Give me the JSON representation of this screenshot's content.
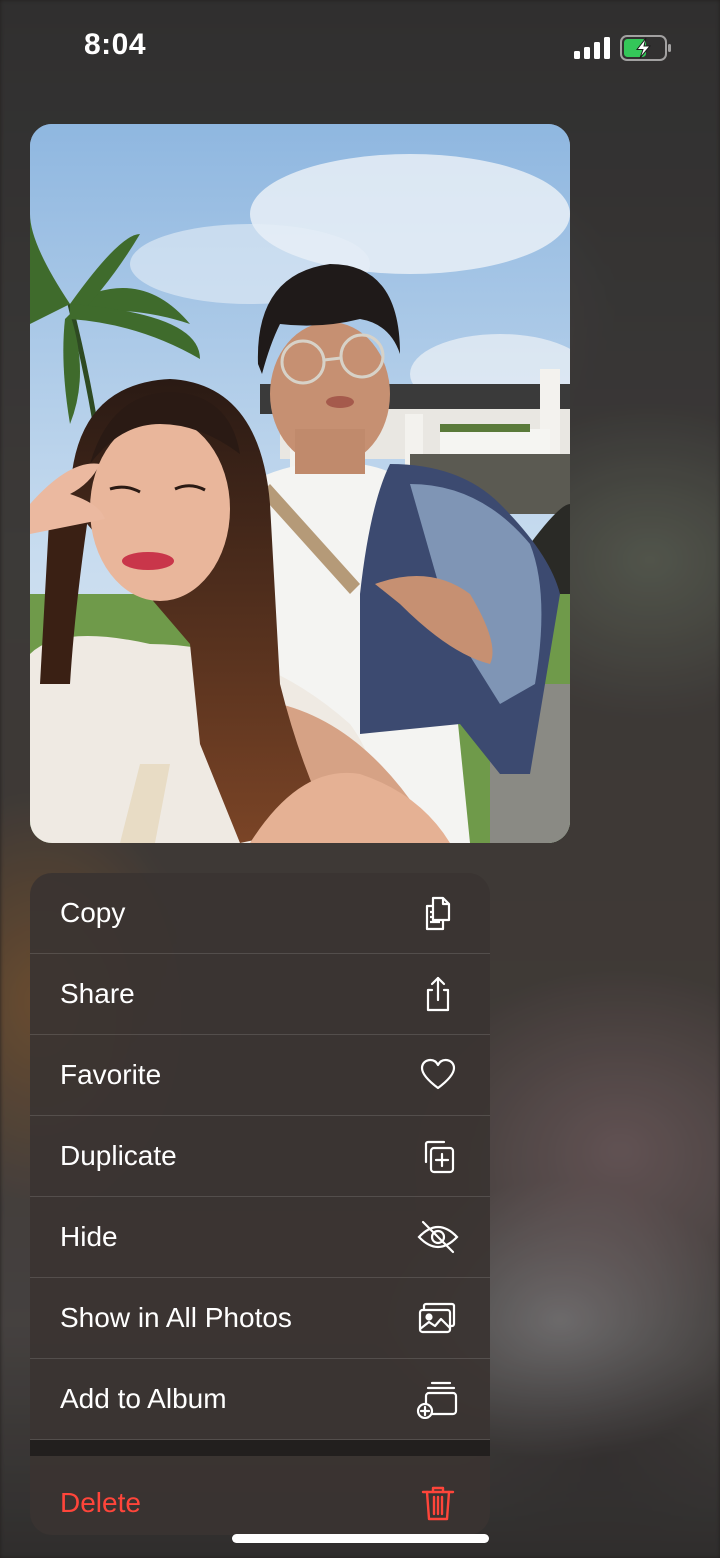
{
  "status_bar": {
    "time": "8:04",
    "signal_icon": "cellular-signal-icon",
    "battery_icon": "battery-charging-icon",
    "battery_color": "#34c759"
  },
  "photo": {
    "description_icon": "photo-thumbnail"
  },
  "menu": {
    "items": [
      {
        "label": "Copy",
        "icon": "copy-icon"
      },
      {
        "label": "Share",
        "icon": "share-icon"
      },
      {
        "label": "Favorite",
        "icon": "heart-icon"
      },
      {
        "label": "Duplicate",
        "icon": "duplicate-icon"
      },
      {
        "label": "Hide",
        "icon": "eye-slash-icon"
      },
      {
        "label": "Show in All Photos",
        "icon": "photos-icon"
      },
      {
        "label": "Add to Album",
        "icon": "add-to-album-icon"
      }
    ],
    "delete": {
      "label": "Delete",
      "icon": "trash-icon",
      "color": "#ff453a"
    }
  }
}
